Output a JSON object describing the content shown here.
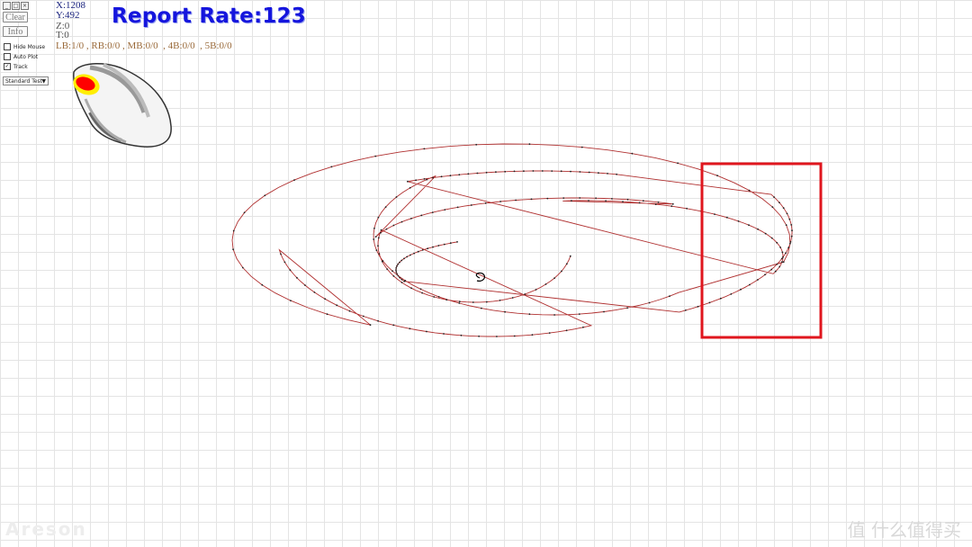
{
  "window_controls": [
    "_",
    "□",
    "×"
  ],
  "toolbar": {
    "clear_label": "Clear",
    "info_label": "Info"
  },
  "options": [
    {
      "label": "Hide Mouse",
      "checked": false
    },
    {
      "label": "Auto Plot",
      "checked": false
    },
    {
      "label": "Track",
      "checked": true
    }
  ],
  "test_mode": {
    "selected": "Standard Test"
  },
  "coordinates": {
    "x": "X:1208",
    "y": "Y:492",
    "z": "Z:0",
    "t": "T:0"
  },
  "report_rate": "Report Rate:123",
  "button_stats": "LB:1/0 , RB:0/0 , MB:0/0  , 4B:0/0  , 5B:0/0",
  "mouse_indicator": {
    "highlighted_button": "left",
    "highlight_color": "#ff0000",
    "ring_color": "#ffee00"
  },
  "track": {
    "color": "#b03030",
    "point_color": "#222222",
    "start_color": "#000000"
  },
  "highlight_box": {
    "color": "#e0161e"
  },
  "watermarks": {
    "left": "Areson",
    "right": "值 什么值得买"
  }
}
